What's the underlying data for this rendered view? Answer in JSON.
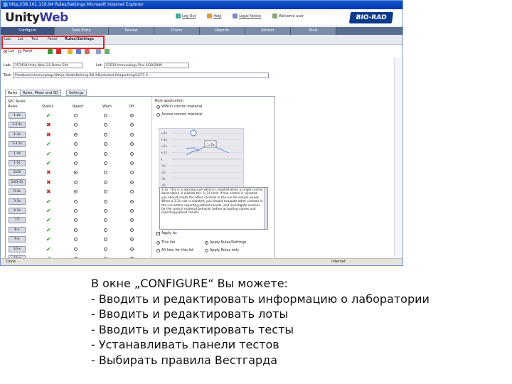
{
  "window": {
    "title": "http://38.101.119.94 Rules/Settings Microsoft Internet Explorer"
  },
  "app": {
    "logo_main": "Unity",
    "logo_sub": "Web",
    "brand": "BIO-RAD",
    "top_links": [
      "Log Out",
      "Help",
      "Legal Notice",
      "Welcome user"
    ]
  },
  "nav": {
    "tabs": [
      "Configure",
      "Data Entry",
      "Review",
      "Charts",
      "Reports",
      "Advisor",
      "Tools"
    ]
  },
  "subnav": {
    "items": [
      "Lab",
      "Lot",
      "Test",
      "Panel",
      "Rules/Settings"
    ]
  },
  "toolbar": {
    "view_options": [
      "Lot",
      "Panel"
    ]
  },
  "filters": {
    "lab_label": "Lab:",
    "lab_value": "257418 Unity Web 2.0 Demo Site",
    "lot_label": "Lot:",
    "lot_value": "52530 Immunology Plus 6/30/2009",
    "test_label": "Test:",
    "test_value": "Prealbumin\\Immunology\\Stheln Dade\\Behring BN II\\Dedicated Reagent\\mg/L\\ET1 0 ..."
  },
  "subtabs": [
    "Rules",
    "Rules, Mean and SD",
    "Settings"
  ],
  "rules_panel": {
    "heading_spc": "SPC Rules",
    "heading_rules": "Rules",
    "col_status": "Status",
    "col_reject": "Reject",
    "col_warn": "Warn",
    "col_off": "Off",
    "rows": [
      {
        "rule": "1-2s",
        "status": "ok",
        "choice": "off"
      },
      {
        "rule": "1-2.5s",
        "status": "bad",
        "choice": "off"
      },
      {
        "rule": "1-3s",
        "status": "bad",
        "choice": "reject"
      },
      {
        "rule": "1-3.5s",
        "status": "ok",
        "choice": "off"
      },
      {
        "rule": "1-4s",
        "status": "ok",
        "choice": "off"
      },
      {
        "rule": "1-5s",
        "status": "ok",
        "choice": "off"
      },
      {
        "rule": "2of3",
        "status": "bad",
        "choice": "reject"
      },
      {
        "rule": "2of3-2s",
        "status": "bad",
        "choice": "off"
      },
      {
        "rule": "R-4s",
        "status": "bad",
        "choice": "reject"
      },
      {
        "rule": "3-1s",
        "status": "ok",
        "choice": "off"
      },
      {
        "rule": "4-1s",
        "status": "ok",
        "choice": "off"
      },
      {
        "rule": "7-T",
        "status": "ok",
        "choice": "off"
      },
      {
        "rule": "8-x",
        "status": "ok",
        "choice": "off"
      },
      {
        "rule": "9-x",
        "status": "ok",
        "choice": "off"
      },
      {
        "rule": "10-x",
        "status": "ok",
        "choice": "off"
      },
      {
        "rule": "12-x",
        "status": "ok",
        "choice": "off"
      }
    ],
    "rule_application_title": "Rule application",
    "within_controls": "Within control material",
    "across_controls": "Across control material",
    "chart_labels": [
      "+4s",
      "+3s",
      "+2s",
      "+1s",
      "x",
      "-1s",
      "-2s",
      "-3s",
      "-4s"
    ],
    "chart_callout": "1-2s",
    "description": "1-2s: This is a warning rule which is violated when a single control observation is outside the +/-2s limit. If one control is rejected, you should check the other controls in the run for similar issues. When a 1-2s rule is violated, you should evaluate other controls in the run before reporting patient results, and investigate reasons for the control material behavior before accepting values and reporting patient results.",
    "apply_to_label": "Apply to:",
    "apply_options": [
      "This list",
      "All lists for this lot",
      "Apply Rules/Settings",
      "Apply Rules only"
    ]
  },
  "statusbar": {
    "left": "Done",
    "right": "Internet"
  },
  "caption": {
    "lines": [
      "В окне „CONFIGURE“ Вы можете:",
      "- Вводить и редактировать информацию о лаборатории",
      "- Вводить и редактировать лоты",
      "- Вводить и редактировать тесты",
      "- Устанавливать панели тестов",
      "- Выбирать правила Вестгарда"
    ]
  }
}
